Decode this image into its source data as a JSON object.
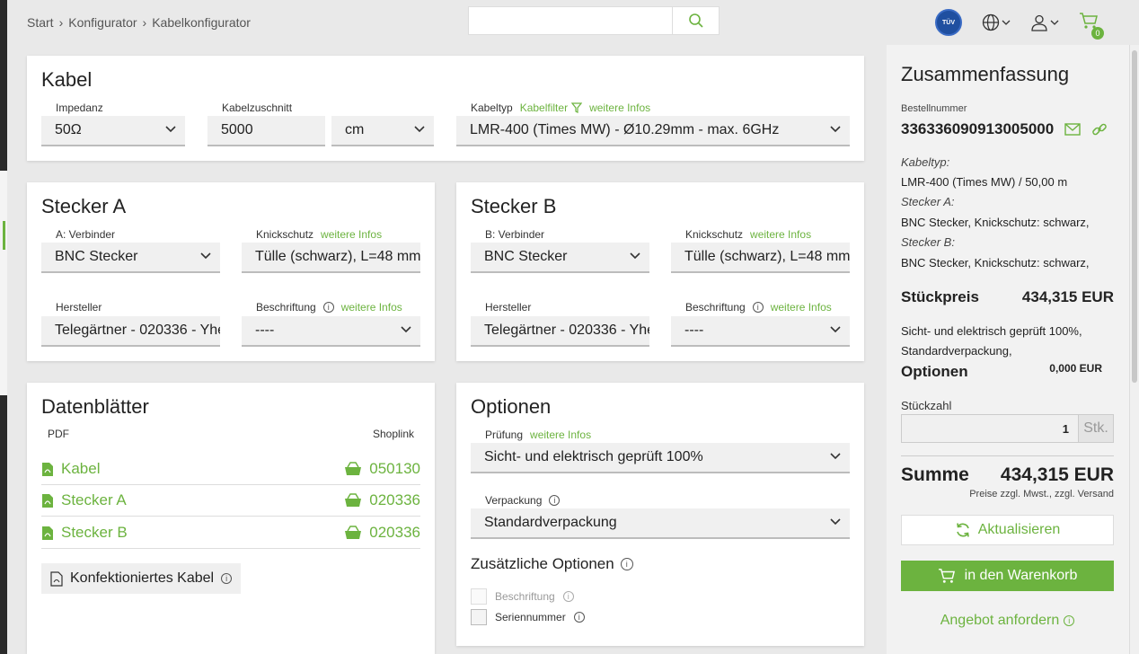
{
  "breadcrumb": [
    "Start",
    "Konfigurator",
    "Kabelkonfigurator"
  ],
  "search": {
    "placeholder": ""
  },
  "header": {
    "tuv_text": "TÜV",
    "cart_count": "0"
  },
  "kabel": {
    "title": "Kabel",
    "impedanz_label": "Impedanz",
    "impedanz_value": "50Ω",
    "zuschnitt_label": "Kabelzuschnitt",
    "zuschnitt_value": "5000",
    "unit_value": "cm",
    "kabeltyp_label": "Kabeltyp",
    "kabelfilter_link": "Kabelfilter",
    "infos_link": "weitere Infos",
    "kabeltyp_value": "LMR-400 (Times MW) - Ø10.29mm - max. 6GHz"
  },
  "stecker_a": {
    "title": "Stecker A",
    "verbinder_label": "A: Verbinder",
    "verbinder_value": "BNC Stecker",
    "knickschutz_label": "Knickschutz",
    "knickschutz_link": "weitere Infos",
    "knickschutz_value": "Tülle (schwarz), L=48 mm",
    "hersteller_label": "Hersteller",
    "hersteller_value": "Telegärtner - 020336 - Yhe",
    "beschriftung_label": "Beschriftung",
    "beschriftung_link": "weitere Infos",
    "beschriftung_value": "----"
  },
  "stecker_b": {
    "title": "Stecker B",
    "verbinder_label": "B: Verbinder",
    "verbinder_value": "BNC Stecker",
    "knickschutz_label": "Knickschutz",
    "knickschutz_link": "weitere Infos",
    "knickschutz_value": "Tülle (schwarz), L=48 mm",
    "hersteller_label": "Hersteller",
    "hersteller_value": "Telegärtner - 020336 - Yhe",
    "beschriftung_label": "Beschriftung",
    "beschriftung_link": "weitere Infos",
    "beschriftung_value": "----"
  },
  "datenblaetter": {
    "title": "Datenblätter",
    "col_pdf": "PDF",
    "col_shop": "Shoplink",
    "rows": [
      {
        "pdf": "Kabel",
        "shop": "050130"
      },
      {
        "pdf": "Stecker A",
        "shop": "020336"
      },
      {
        "pdf": "Stecker B",
        "shop": "020336"
      }
    ],
    "konfektioniert": "Konfektioniertes Kabel"
  },
  "optionen": {
    "title": "Optionen",
    "pruefung_label": "Prüfung",
    "pruefung_link": "weitere Infos",
    "pruefung_value": "Sicht- und elektrisch geprüft 100%",
    "verpackung_label": "Verpackung",
    "verpackung_value": "Standardverpackung",
    "zusatz_title": "Zusätzliche Optionen",
    "chk_beschriftung": "Beschriftung",
    "chk_seriennummer": "Seriennummer"
  },
  "summary": {
    "title": "Zusammenfassung",
    "bestellnummer_label": "Bestellnummer",
    "bestellnummer": "336336090913005000",
    "kabeltyp_label": "Kabeltyp:",
    "kabeltyp_value": "LMR-400 (Times MW) / 50,00 m",
    "stecker_a_label": "Stecker A:",
    "stecker_a_value": "BNC Stecker, Knickschutz: schwarz,",
    "stecker_b_label": "Stecker B:",
    "stecker_b_value": "BNC Stecker, Knickschutz: schwarz,",
    "stueckpreis_label": "Stückpreis",
    "stueckpreis_value": "434,315 EUR",
    "options_line1": "Sicht- und elektrisch geprüft 100%,",
    "options_line2": "Standardverpackung,",
    "optionen_label": "Optionen",
    "optionen_value": "0,000 EUR",
    "stueckzahl_label": "Stückzahl",
    "stueckzahl_value": "1",
    "stueckzahl_unit": "Stk.",
    "summe_label": "Summe",
    "summe_value": "434,315 EUR",
    "summe_note": "Preise zzgl. Mwst., zzgl. Versand",
    "aktualisieren": "Aktualisieren",
    "warenkorb": "in den Warenkorb",
    "angebot": "Angebot anfordern"
  },
  "colors": {
    "accent": "#6cb33f",
    "background": "#e9e9e9",
    "card": "#ffffff"
  }
}
